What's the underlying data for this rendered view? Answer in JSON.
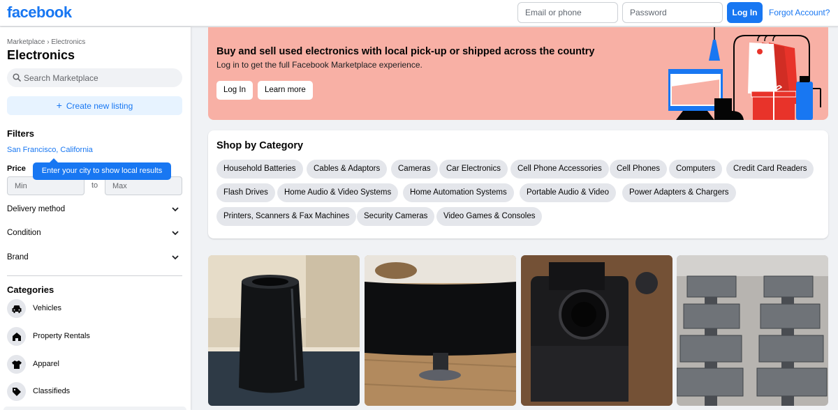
{
  "header": {
    "logo": "facebook",
    "email_placeholder": "Email or phone",
    "password_placeholder": "Password",
    "login_label": "Log In",
    "forgot_label": "Forgot Account?"
  },
  "sidebar": {
    "breadcrumb": "Marketplace › Electronics",
    "title": "Electronics",
    "search_placeholder": "Search Marketplace",
    "create_label": "Create new listing",
    "filters_title": "Filters",
    "location": "San Francisco, California",
    "tooltip": "Enter your city to show local results",
    "price_label": "Price",
    "price_min_placeholder": "Min",
    "price_to": "to",
    "price_max_placeholder": "Max",
    "filter_rows": [
      "Delivery method",
      "Condition",
      "Brand"
    ],
    "categories_title": "Categories",
    "categories": [
      {
        "label": "Vehicles",
        "icon": "car-icon"
      },
      {
        "label": "Property Rentals",
        "icon": "house-icon"
      },
      {
        "label": "Apparel",
        "icon": "shirt-icon"
      },
      {
        "label": "Classifieds",
        "icon": "tag-icon"
      }
    ]
  },
  "banner": {
    "title": "Buy and sell used electronics with local pick-up or shipped across the country",
    "subtitle": "Log in to get the full Facebook Marketplace experience.",
    "login_label": "Log In",
    "learn_more_label": "Learn more"
  },
  "shop": {
    "title": "Shop by Category",
    "chips": [
      "Household Batteries",
      "Cables & Adaptors",
      "Cameras",
      "Car Electronics",
      "Cell Phone Accessories",
      "Cell Phones",
      "Computers",
      "Credit Card Readers",
      "Flash Drives",
      "Home Audio & Video Systems",
      "Home Automation Systems",
      "Portable Audio & Video",
      "Power Adapters & Chargers",
      "Printers, Scanners & Fax Machines",
      "Security Cameras",
      "Video Games & Consoles"
    ]
  },
  "listings": [
    {
      "icon": "mac-pro-photo"
    },
    {
      "icon": "curved-monitor-photo"
    },
    {
      "icon": "nikon-camera-photo"
    },
    {
      "icon": "imac-stack-photo"
    }
  ],
  "colors": {
    "brand": "#1877f2",
    "banner_bg": "#f8b0a5",
    "page_bg": "#f0f2f5"
  }
}
